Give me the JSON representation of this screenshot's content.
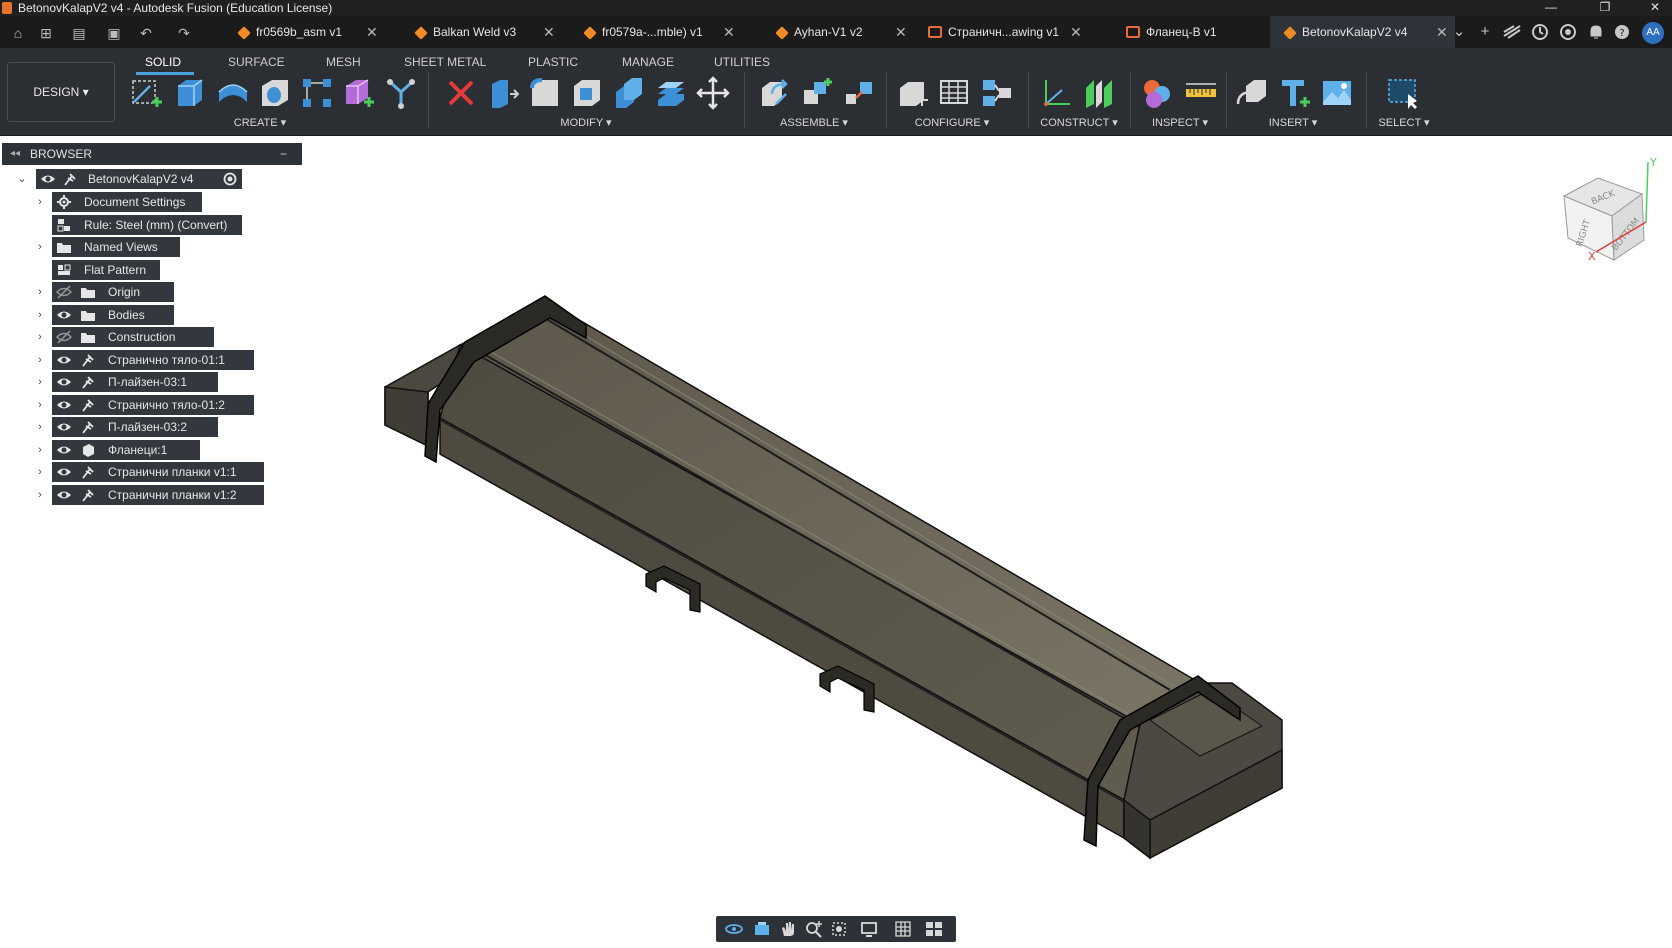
{
  "window": {
    "title": "BetonovKalapV2 v4 - Autodesk Fusion (Education License)",
    "minimize": "—",
    "restore": "❐",
    "close": "✕"
  },
  "quick_access": {
    "home_icon": "⌂",
    "grid_icon": "⊞",
    "file_icon": "▤",
    "save_icon": "▣",
    "undo_icon": "↶",
    "redo_icon": "↷"
  },
  "doc_tabs": [
    {
      "label": "fr0569b_asm v1",
      "icon": "cube-icon",
      "close": "✕"
    },
    {
      "label": "Balkan Weld v3",
      "icon": "cube-icon",
      "close": "✕"
    },
    {
      "label": "fr0579a-...mble) v1",
      "icon": "cube-icon",
      "close": "✕"
    },
    {
      "label": "Ayhan-V1 v2",
      "icon": "cube-icon",
      "close": "✕"
    },
    {
      "label": "Страничн...awing v1",
      "icon": "drawing-icon",
      "close": "✕"
    },
    {
      "label": "Фланец-В v1",
      "icon": "drawing-icon",
      "close": ""
    },
    {
      "label": "BetonovKalapV2 v4",
      "icon": "cube-icon",
      "close": "✕"
    }
  ],
  "tabbar_right": {
    "more": "⌄",
    "new_tab": "+",
    "avatar": "AA"
  },
  "ribbon": {
    "workspace": "DESIGN",
    "tabs": [
      {
        "label": "SOLID",
        "active": true
      },
      {
        "label": "SURFACE",
        "active": false
      },
      {
        "label": "MESH",
        "active": false
      },
      {
        "label": "SHEET METAL",
        "active": false
      },
      {
        "label": "PLASTIC",
        "active": false
      },
      {
        "label": "MANAGE",
        "active": false
      },
      {
        "label": "UTILITIES",
        "active": false
      }
    ],
    "groups": [
      {
        "label": "CREATE ▾"
      },
      {
        "label": "MODIFY ▾"
      },
      {
        "label": "ASSEMBLE ▾"
      },
      {
        "label": "CONFIGURE ▾"
      },
      {
        "label": "CONSTRUCT ▾"
      },
      {
        "label": "INSPECT ▾"
      },
      {
        "label": "INSERT ▾"
      },
      {
        "label": "SELECT ▾"
      }
    ],
    "accent": "#4aa3df"
  },
  "browser": {
    "header": "BROWSER",
    "collapse": "−",
    "root": "BetonovKalapV2 v4",
    "items": [
      {
        "label": "Document Settings",
        "icon": "gear-icon",
        "expandable": true,
        "eye": false
      },
      {
        "label": "Rule: Steel (mm) (Convert)",
        "icon": "rule-icon",
        "expandable": false,
        "eye": false
      },
      {
        "label": "Named Views",
        "icon": "folder-icon",
        "expandable": true,
        "eye": false
      },
      {
        "label": "Flat Pattern",
        "icon": "flat-pattern-icon",
        "expandable": false,
        "eye": false
      },
      {
        "label": "Origin",
        "icon": "folder-icon",
        "expandable": true,
        "eye": "hidden"
      },
      {
        "label": "Bodies",
        "icon": "folder-icon",
        "expandable": true,
        "eye": "visible"
      },
      {
        "label": "Construction",
        "icon": "folder-icon",
        "expandable": true,
        "eye": "hidden"
      },
      {
        "label": "Странично тяло-01:1",
        "icon": "component-icon",
        "expandable": true,
        "eye": "visible"
      },
      {
        "label": "П-лайзен-03:1",
        "icon": "component-icon",
        "expandable": true,
        "eye": "visible"
      },
      {
        "label": "Странично тяло-01:2",
        "icon": "component-icon",
        "expandable": true,
        "eye": "visible"
      },
      {
        "label": "П-лайзен-03:2",
        "icon": "component-icon",
        "expandable": true,
        "eye": "visible"
      },
      {
        "label": "Фланеци:1",
        "icon": "body-icon",
        "expandable": true,
        "eye": "visible"
      },
      {
        "label": "Странични планки v1:1",
        "icon": "component-icon",
        "expandable": true,
        "eye": "visible"
      },
      {
        "label": "Странични планки v1:2",
        "icon": "component-icon",
        "expandable": true,
        "eye": "visible"
      }
    ]
  },
  "viewcube": {
    "faces": [
      "BACK",
      "RIGHT",
      "BOTTOM"
    ],
    "axes": [
      "X",
      "Y"
    ]
  }
}
